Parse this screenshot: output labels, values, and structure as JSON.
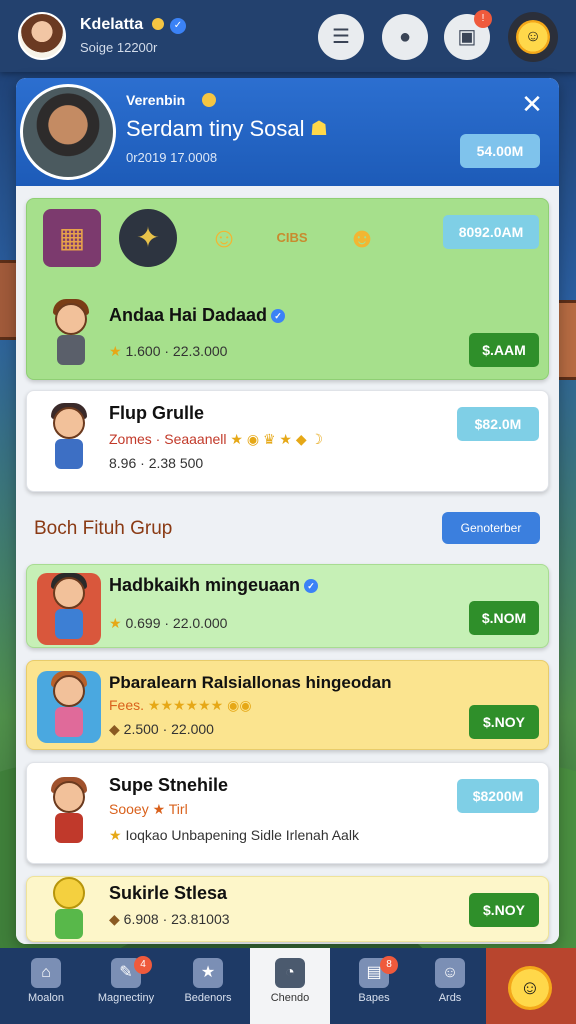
{
  "topbar": {
    "user_name": "Kdelatta",
    "user_sub": "Soige 12200r",
    "icons": [
      "chat-icon",
      "map-pin-icon",
      "gamepad-icon"
    ],
    "notif_count": "1",
    "notif_glyph": "!"
  },
  "header": {
    "kicker": "Verenbin",
    "title": "Serdam tiny Sosal",
    "sub": "0r2019 17.0008",
    "price": "54.00M",
    "close_glyph": "✕"
  },
  "cards": [
    {
      "title": "Andaa Hai Dadaad",
      "meta": "1.600 · 22.3.000",
      "button": "$.AAM",
      "items_price": "8092.0AM",
      "items_label": "CIBS"
    },
    {
      "title": "Flup Grulle",
      "sub": "Zomes · Seaaanell",
      "meta": "8.96 · 2.38 500",
      "button": "$82.0M"
    },
    {
      "title": "Hadbkaikh mingeuaan",
      "meta": "0.699 · 22.0.000",
      "button": "$.NOM"
    },
    {
      "title": "Pbaralearn Ralsiallonas hingeodan",
      "sub": "Fees.",
      "meta": "2.500 · 22.000",
      "button": "$.NOY"
    },
    {
      "title": "Supe Stnehile",
      "sub": "Sooey ★ Tirl",
      "meta": "Ioqkao Unbapening Sidle Irlenah Aalk",
      "button": "$8200M"
    },
    {
      "title": "Sukirle Stlesa",
      "meta": "6.908 · 23.81003",
      "button": "$.NOY"
    }
  ],
  "section": {
    "title": "Boch Fituh Grup",
    "button": "Genoterber"
  },
  "bottomnav": {
    "items": [
      {
        "label": "Moalon",
        "icon": "home-icon"
      },
      {
        "label": "Magnectiny",
        "icon": "tools-icon"
      },
      {
        "label": "Bedenors",
        "icon": "star-icon"
      },
      {
        "label": "Chendo",
        "icon": "chat-bubble-icon"
      },
      {
        "label": "Bapes",
        "icon": "store-icon"
      },
      {
        "label": "Ards",
        "icon": "profile-icon"
      }
    ],
    "badge_count": "4",
    "badge_count_2": "8"
  },
  "colors": {
    "topbar": "#23416e",
    "header_blue": "#2c6fd0",
    "green_button": "#2f8f2a",
    "blue_button": "#7fcfe6",
    "card_green": "#a6e08c",
    "card_yellow": "#fbe48f"
  }
}
